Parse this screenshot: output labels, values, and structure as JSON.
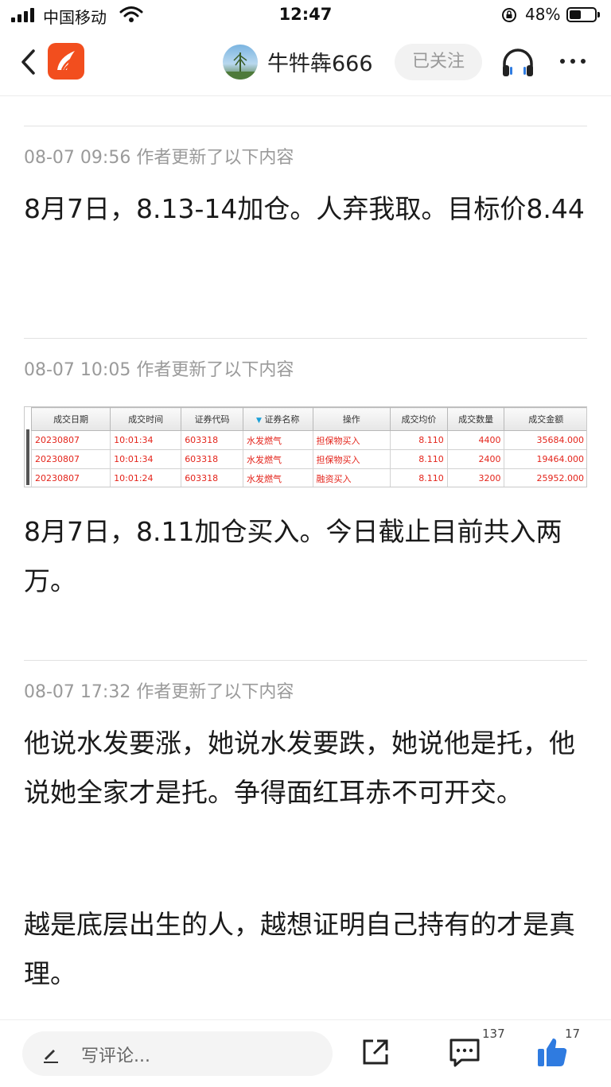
{
  "status_bar": {
    "carrier": "中国移动",
    "time": "12:47",
    "battery_percent": "48%",
    "battery_level": 0.48
  },
  "nav": {
    "author_name": "牛牪犇666",
    "follow_label": "已关注"
  },
  "updates": [
    {
      "meta": "08-07 09:56 作者更新了以下内容",
      "text": "8月7日，8.13-14加仓。人弃我取。目标价8.44"
    },
    {
      "meta": "08-07 10:05 作者更新了以下内容",
      "text": "8月7日，8.11加仓买入。今日截止目前共入两万。"
    },
    {
      "meta": "08-07 17:32 作者更新了以下内容",
      "text": "他说水发要涨，她说水发要跌，她说他是托，他说她全家才是托。争得面红耳赤不可开交。",
      "text2": "越是底层出生的人，越想证明自己持有的才是真理。"
    }
  ],
  "trade_table": {
    "headers": [
      "成交日期",
      "成交时间",
      "证券代码",
      "证券名称",
      "操作",
      "成交均价",
      "成交数量",
      "成交金额"
    ],
    "rows": [
      [
        "20230807",
        "10:01:34",
        "603318",
        "水发燃气",
        "担保物买入",
        "8.110",
        "4400",
        "35684.000"
      ],
      [
        "20230807",
        "10:01:34",
        "603318",
        "水发燃气",
        "担保物买入",
        "8.110",
        "2400",
        "19464.000"
      ],
      [
        "20230807",
        "10:01:24",
        "603318",
        "水发燃气",
        "融资买入",
        "8.110",
        "3200",
        "25952.000"
      ]
    ],
    "text_color": "#e4241b"
  },
  "bottom_bar": {
    "comment_placeholder": "写评论...",
    "comment_count": "137",
    "like_count": "17"
  },
  "colors": {
    "brand": "#f24e1e",
    "like": "#2f7be0"
  },
  "icons": [
    "back-icon",
    "app-logo-icon",
    "headphone-icon",
    "more-icon",
    "pen-icon",
    "share-icon",
    "comment-icon",
    "like-icon",
    "wifi-icon",
    "lock-icon",
    "battery-icon",
    "signal-icon"
  ]
}
